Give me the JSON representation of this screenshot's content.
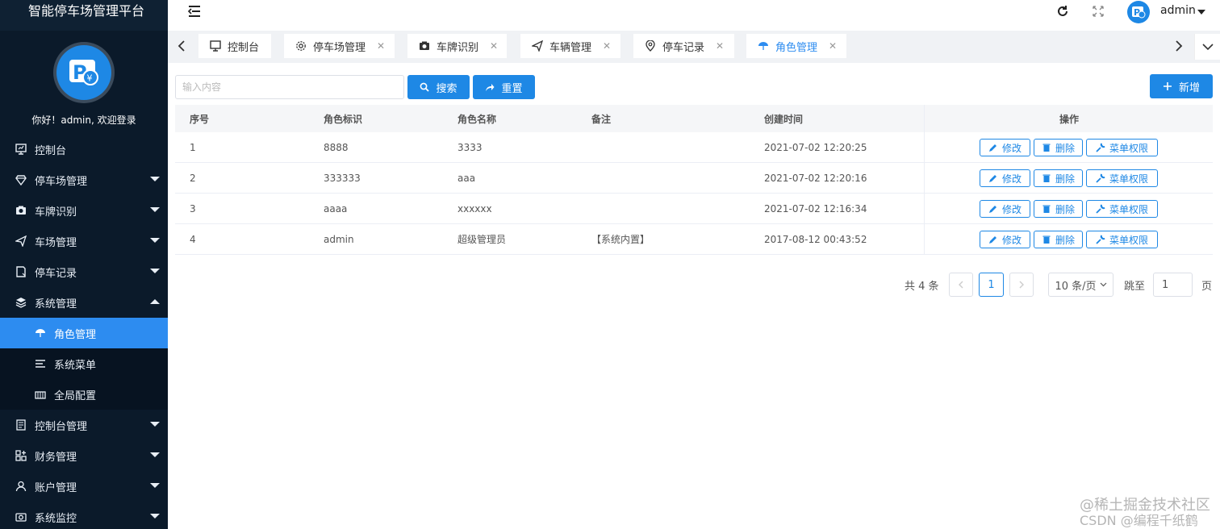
{
  "sidebar": {
    "brand": "智能停车场管理平台",
    "welcome": "你好！admin, 欢迎登录",
    "items": [
      {
        "label": "控制台",
        "icon": "monitor-icon",
        "expandable": false
      },
      {
        "label": "停车场管理",
        "icon": "diamond-icon",
        "expandable": true
      },
      {
        "label": "车牌识别",
        "icon": "camera-icon",
        "expandable": true
      },
      {
        "label": "车场管理",
        "icon": "send-icon",
        "expandable": true
      },
      {
        "label": "停车记录",
        "icon": "note-icon",
        "expandable": true
      },
      {
        "label": "系统管理",
        "icon": "layers-icon",
        "expandable": true,
        "expanded": true
      },
      {
        "label": "角色管理",
        "icon": "umbrella-icon",
        "sub": true,
        "active": true
      },
      {
        "label": "系统菜单",
        "icon": "list-icon",
        "sub": true
      },
      {
        "label": "全局配置",
        "icon": "config-icon",
        "sub": true
      },
      {
        "label": "控制台管理",
        "icon": "doc-icon",
        "expandable": true
      },
      {
        "label": "财务管理",
        "icon": "grid-icon",
        "expandable": true
      },
      {
        "label": "账户管理",
        "icon": "user-icon",
        "expandable": true
      },
      {
        "label": "系统监控",
        "icon": "camera2-icon",
        "expandable": true
      }
    ]
  },
  "header": {
    "username": "admin"
  },
  "tags": [
    {
      "label": "控制台",
      "icon": "monitor-icon",
      "closable": false
    },
    {
      "label": "停车场管理",
      "icon": "gear-icon",
      "closable": true
    },
    {
      "label": "车牌识别",
      "icon": "camera-icon",
      "closable": true
    },
    {
      "label": "车辆管理",
      "icon": "send-icon",
      "closable": true
    },
    {
      "label": "停车记录",
      "icon": "location-icon",
      "closable": true
    },
    {
      "label": "角色管理",
      "icon": "umbrella-icon",
      "closable": true,
      "active": true
    }
  ],
  "toolbar": {
    "search_placeholder": "输入内容",
    "search_label": "搜索",
    "reset_label": "重置",
    "add_label": "新增"
  },
  "table": {
    "columns": [
      "序号",
      "角色标识",
      "角色名称",
      "备注",
      "创建时间",
      "操作"
    ],
    "rows": [
      {
        "index": "1",
        "key": "8888",
        "name": "3333",
        "remark": "",
        "created": "2021-07-02 12:20:25"
      },
      {
        "index": "2",
        "key": "333333",
        "name": "aaa",
        "remark": "",
        "created": "2021-07-02 12:20:16"
      },
      {
        "index": "3",
        "key": "aaaa",
        "name": "xxxxxx",
        "remark": "",
        "created": "2021-07-02 12:16:34"
      },
      {
        "index": "4",
        "key": "admin",
        "name": "超级管理员",
        "remark": "【系统内置】",
        "created": "2017-08-12 00:43:52"
      }
    ],
    "ops": {
      "edit": "修改",
      "delete": "删除",
      "perm": "菜单权限"
    }
  },
  "pagination": {
    "total": "共 4 条",
    "current": "1",
    "page_size": "10 条/页",
    "jump_label": "跳至",
    "jump_value": "1",
    "page_suffix": "页"
  },
  "watermark": {
    "line1": "@稀土掘金技术社区",
    "line2": "CSDN @编程千纸鹤"
  },
  "colors": {
    "primary": "#1e88e5",
    "sidebar": "#0b1a2a",
    "active": "#2d8cf0"
  }
}
